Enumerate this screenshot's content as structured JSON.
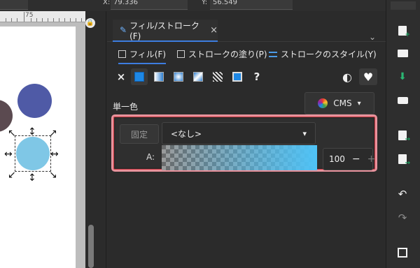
{
  "topbar": {
    "x_label": "X:",
    "x_value": "79.336",
    "y_label": "Y:",
    "y_value": "56.549"
  },
  "ruler": {
    "label": "75"
  },
  "dialog": {
    "tab_title": "フィル/ストローク(F)",
    "tab_close": "×",
    "chevron": "⌄",
    "subtabs": {
      "fill": "フィル(F)",
      "stroke_paint": "ストロークの塗り(P)",
      "stroke_style": "ストロークのスタイル(Y)"
    },
    "paint_types": {
      "none": "×",
      "unknown": "?"
    },
    "flat_label": "単一色",
    "cms": {
      "label": "CMS",
      "caret": "▾"
    },
    "lock_label": "固定",
    "color_select": {
      "value": "<なし>",
      "caret": "▾"
    },
    "alpha": {
      "label": "A:",
      "value": "100",
      "minus": "−",
      "plus": "+"
    }
  },
  "right_toolbar": {
    "undo": "↶",
    "redo": "↷"
  }
}
